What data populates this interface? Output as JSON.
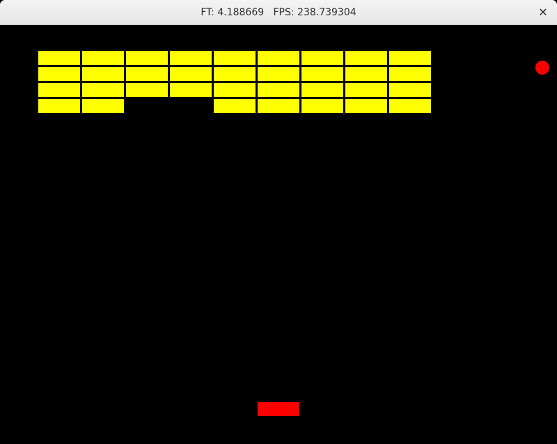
{
  "window": {
    "title": "FT: 4.188669   FPS: 238.739304",
    "close_glyph": "✕"
  },
  "game": {
    "background_color": "#000000",
    "brick_color": "#ffff00",
    "paddle_color": "#ff0000",
    "ball_color": "#ff0000",
    "brick_grid": {
      "columns": 9,
      "rows": 4,
      "present": [
        [
          1,
          1,
          1,
          1,
          1,
          1,
          1,
          1,
          1
        ],
        [
          1,
          1,
          1,
          1,
          1,
          1,
          1,
          1,
          1
        ],
        [
          1,
          1,
          1,
          1,
          1,
          1,
          1,
          1,
          1
        ],
        [
          1,
          1,
          0,
          0,
          1,
          1,
          1,
          1,
          1
        ]
      ]
    }
  }
}
